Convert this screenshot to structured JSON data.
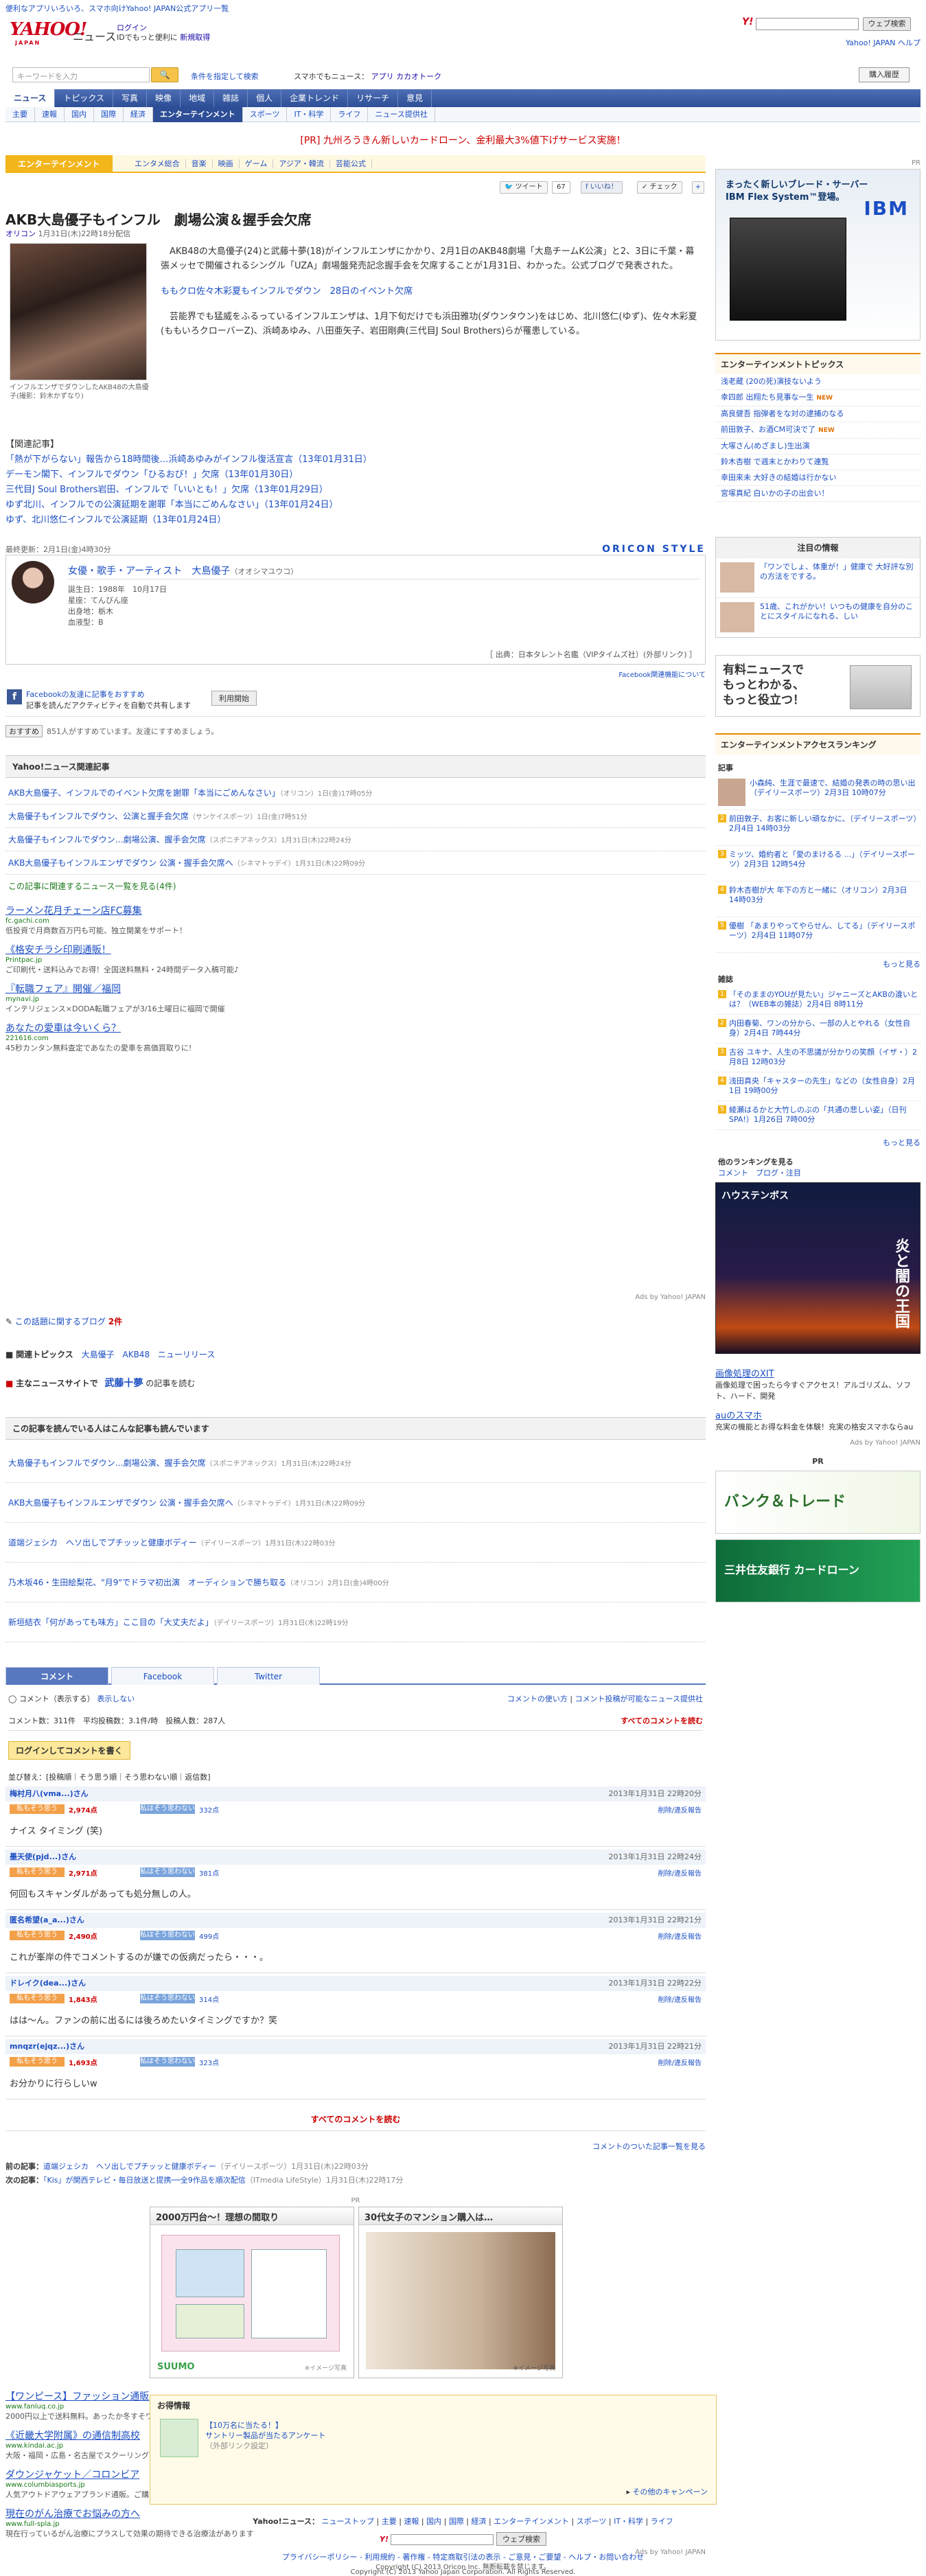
{
  "topbar": {
    "promo1": "便利なアプリいろいろ、スマホ向けYahoo! JAPAN公式アプリ一覧"
  },
  "header": {
    "logo": "YAHOO!",
    "logo_sub": "JAPAN",
    "service": "ニュース",
    "login": "ログイン",
    "login_sub": "IDでもっと便利に",
    "register": "新規取得",
    "search_btn": "ウェブ検索",
    "links": "Yahoo! JAPAN ヘルプ"
  },
  "search": {
    "placeholder": "キーワードを入力",
    "btn": "検索",
    "condition": "条件を指定して検索",
    "smartphone": "スマホでもニュース：",
    "app": "アプリ",
    "calendar": "カカオトーク",
    "buy": "購入履歴"
  },
  "nav1": [
    "ニュース",
    "トピックス",
    "写真",
    "映像",
    "地域",
    "雑誌",
    "個人",
    "企業トレンド",
    "リサーチ",
    "意見"
  ],
  "nav2": [
    "主要",
    "速報",
    "国内",
    "国際",
    "経済",
    "エンターテインメント",
    "スポーツ",
    "IT・科学",
    "ライフ",
    "ニュース提供社"
  ],
  "pr_top": "[PR] 九州ろうきん新しいカードローン、金利最大3%値下げサービス実施！",
  "category": {
    "label": "エンターテインメント",
    "items": [
      "エンタメ総合",
      "音楽",
      "映画",
      "ゲーム",
      "アジア・韓流",
      "芸能公式"
    ]
  },
  "share": {
    "tweet": "ツイート",
    "tweet_count": "67",
    "like": "いいね！",
    "check": "チェック"
  },
  "article": {
    "title": "AKB大島優子もインフル　劇場公演＆握手会欠席",
    "source": "オリコン",
    "date": "1月31日(木)22時18分配信",
    "caption": "インフルエンザでダウンしたAKB48の大島優子(撮影：鈴木かずなり)",
    "para1": "AKB48の大島優子(24)と武藤十夢(18)がインフルエンザにかかり、2月1日のAKB48劇場「大島チームK公演」と2、3日に千葉・幕張メッセで開催されるシングル「UZA」劇場盤発売記念握手会を欠席することが1月31日、わかった。公式ブログで発表された。",
    "inline_link": "ももクロ佐々木彩夏もインフルでダウン　28日のイベント欠席",
    "para2": "芸能界でも猛威をふるっているインフルエンザは、1月下旬だけでも浜田雅功(ダウンタウン)をはじめ、北川悠仁(ゆず)、佐々木彩夏(ももいろクローバーZ)、浜崎あゆみ、八田亜矢子、岩田剛典(三代目J Soul Brothers)らが罹患している。",
    "related_head": "【関連記事】",
    "related": [
      "「熱が下がらない」報告から18時間後…浜崎あゆみがインフル復活宣言（13年01月31日）",
      "デーモン閣下、インフルでダウン「ひるおび！」欠席（13年01月30日）",
      "三代目J Soul Brothers岩田、インフルで「いいとも！」欠席（13年01月29日）",
      "ゆず北川、インフルでの公演延期を謝罪「本当にごめんなさい」（13年01月24日）",
      "ゆず、北川悠仁インフルで公演延期（13年01月24日）"
    ],
    "updated": "最終更新：2月1日(金)4時30分",
    "oricon": "ORICON STYLE"
  },
  "profile": {
    "name": "女優・歌手・アーティスト　大島優子",
    "kana": "（オオシマユウコ）",
    "facts": [
      "誕生日：1988年　10月17日",
      "星座：てんびん座",
      "出身地：栃木",
      "血液型：B"
    ],
    "source": "［ 出典：日本タレント名鑑（VIPタイムズ社）(外部リンク) ］",
    "fb_info": "Facebook関連機能について"
  },
  "facebook": {
    "line1": "Facebookの友達に記事をおすすめ",
    "line2": "記事を読んだアクティビティを自動で共有します",
    "btn": "利用開始",
    "likes_btn": "おすすめ",
    "likes": "851人がすすめています。友達にすすめましょう。"
  },
  "related_news": {
    "header": "Yahoo!ニュース関連記事",
    "items": [
      {
        "t": "AKB大島優子、インフルでのイベント欠席を謝罪「本当にごめんなさい」",
        "s": "（オリコン）1日(金)17時05分"
      },
      {
        "t": "大島優子もインフルでダウン、公演と握手会欠席",
        "s": "（サンケイスポーツ）1日(金)7時51分"
      },
      {
        "t": "大島優子もインフルでダウン…劇場公演、握手会欠席",
        "s": "（スポニチアネックス）1月31日(木)22時24分"
      },
      {
        "t": "AKB大島優子もインフルエンザでダウン 公演・握手会欠席へ",
        "s": "（シネマトゥデイ）1月31日(木)22時09分"
      }
    ],
    "all": "この記事に関連するニュース一覧を見る(4件)"
  },
  "ads": [
    {
      "t": "ラーメン花月チェーン店FC募集",
      "u": "fc.gachi.com",
      "d": "低投資で月商数百万円も可能、独立開業をサポート！"
    },
    {
      "t": "《格安チラシ印刷通販！",
      "u": "Printpac.jp",
      "d": "ご印刷代・送料込みでお得！全国送料無料・24時間データ入稿可能♪"
    },
    {
      "t": "『転職フェア』開催／福岡",
      "u": "mynavi.jp",
      "d": "インテリジェンス×DODA転職フェアが3/16土曜日に福岡で開催"
    },
    {
      "t": "あなたの愛車は今いくら？",
      "u": "221616.com",
      "d": "45秒カンタン無料査定であなたの愛車を高価買取りに!"
    }
  ],
  "ads_by": "Ads by Yahoo! JAPAN",
  "blog": {
    "label": "この話題に関するブログ",
    "count": "2件"
  },
  "topics": {
    "label": "関連トピックス",
    "items": [
      "大島優子",
      "AKB48",
      "ニューリリース"
    ]
  },
  "news_source": {
    "label": "主なニュースサイトで",
    "name": "武藤十夢",
    "suffix": "の記事を読む"
  },
  "also_read": {
    "header": "この記事を読んでいる人はこんな記事も読んでいます",
    "items": [
      {
        "t": "大島優子もインフルでダウン…劇場公演、握手会欠席",
        "s": "（スポニチアネックス）1月31日(木)22時24分"
      },
      {
        "t": "AKB大島優子もインフルエンザでダウン 公演・握手会欠席へ",
        "s": "（シネマトゥデイ）1月31日(木)22時09分"
      },
      {
        "t": "道端ジェシカ　ヘソ出しでプチッッと健康ボディー",
        "s": "（デイリースポーツ）1月31日(木)22時03分"
      },
      {
        "t": "乃木坂46・生田絵梨花、\"月9\"でドラマ初出演　オーディションで勝ち取る",
        "s": "（オリコン）2月1日(金)4時00分"
      },
      {
        "t": "新垣結衣「何があっても味方」ここ目の「大丈夫だよ」",
        "s": "（デイリースポーツ）1月31日(木)22時19分"
      }
    ]
  },
  "comments_tabs": [
    "コメント",
    "Facebook",
    "Twitter"
  ],
  "comments": {
    "show": "コメント（表示する）",
    "hide": "表示しない",
    "howto": "コメントの使い方",
    "rule": "コメント投稿が可能なニュース提供社",
    "stats": "コメント数：311件　平均投稿数：3.1件/時　投稿人数：287人",
    "all": "すべてのコメントを読む",
    "login_btn": "ログインしてコメントを書く",
    "sort": "並び替え：[投稿順｜そう思う順｜そう思わない順｜返信数]",
    "list": [
      {
        "name": "梅村月八(vma...)さん",
        "time": "2013年1月31日 22時20分",
        "agree_label": "私もそう思う",
        "agree": "2,974点",
        "dis_label": "私はそう思わない",
        "dis": "332点",
        "report": "削除/違反報告",
        "text": "ナイス タイミング (笑)"
      },
      {
        "name": "墨天使(pjd...)さん",
        "time": "2013年1月31日 22時24分",
        "agree_label": "私もそう思う",
        "agree": "2,971点",
        "dis_label": "私はそう思わない",
        "dis": "381点",
        "report": "削除/違反報告",
        "text": "何回もスキャンダルがあっても処分無しの人。"
      },
      {
        "name": "匿名希望(a_a...)さん",
        "time": "2013年1月31日 22時21分",
        "agree_label": "私もそう思う",
        "agree": "2,490点",
        "dis_label": "私はそう思わない",
        "dis": "499点",
        "report": "削除/違反報告",
        "text": "これが峯岸の件でコメントするのが嫌での仮病だったら・・・。"
      },
      {
        "name": "ドレイク(dea...)さん",
        "time": "2013年1月31日 22時22分",
        "agree_label": "私もそう思う",
        "agree": "1,843点",
        "dis_label": "私はそう思わない",
        "dis": "314点",
        "report": "削除/違反報告",
        "text": "はは～ん。ファンの前に出るには後ろめたいタイミングですか？笑"
      },
      {
        "name": "mnqzr(ejqz...)さん",
        "time": "2013年1月31日 22時21分",
        "agree_label": "私もそう思う",
        "agree": "1,693点",
        "dis_label": "私はそう思わない",
        "dis": "323点",
        "report": "削除/違反報告",
        "text": "お分かりに行らしいw"
      }
    ],
    "all2": "すべてのコメントを読む",
    "list_link": "コメントのついた記事一覧を見る"
  },
  "prev_next": {
    "prev_label": "前の記事：",
    "prev": "道端ジェシカ　ヘソ出しでプチッッと健康ボディー",
    "prev_s": "（デイリースポーツ）1月31日(木)22時03分",
    "next_label": "次の記事：",
    "next": "「Kis」が関西テレビ・毎日放送と提携──全9作品を順次配信",
    "next_s": "（ITmedia LifeStyle）1月31日(木)22時17分"
  },
  "display_ad": {
    "pr": "PR",
    "left": "2000万円台～！理想の間取り",
    "right": "30代女子のマンション購入は…",
    "brand": "SUUMO",
    "img_note": "※イメージ写真"
  },
  "ads2": [
    {
      "t": "【ワンピース】ファッション通販",
      "u": "www.fanluq.co.jp",
      "d": "2000円以上で送料無料。あったか冬すそワンピース特売中です！"
    },
    {
      "t": "《近畿大学附属》の通信制高校",
      "u": "www.kindai.ac.jp",
      "d": "大阪・福岡・広島・名古屋でスクーリング可能！近大の完全サポートが魅力"
    },
    {
      "t": "ダウンジャケット／コロンビア",
      "u": "www.columbiasports.jp",
      "d": "人気アウトドアウェアブランド通販。ご購入で送料無料！新作アイテム続々入荷"
    },
    {
      "t": "現在のがん治療でお悩みの方へ",
      "u": "www.full-spla.jp",
      "d": "現在行っているがん治療にプラスして効果の期待できる治療法があります"
    }
  ],
  "otoku": {
    "title": "お得情報",
    "l1": "【10万名に当たる！】",
    "l2": "サントリー製品が当たるアンケート",
    "l3": "（外部リンク設定）",
    "campaign": "その他のキャンペーン"
  },
  "bottom_nav": {
    "label": "Yahoo!ニュース：",
    "items": [
      "ニューストップ",
      "主要",
      "速報",
      "国内",
      "国際",
      "経済",
      "エンターテインメント",
      "スポーツ",
      "IT・科学",
      "ライフ"
    ]
  },
  "footer": {
    "search_btn": "ウェブ検索",
    "links": "プライバシーポリシー - 利用規約 - 著作権 - 特定商取引法の表示 - ご意見・ご要望 - ヘルプ・お問い合わせ",
    "c1": "Copyright (C) 2013 Oricon Inc. 無断転載を禁じます。",
    "c2": "Copyright (C) 2013 Yahoo Japan Corporation. All Rights Reserved."
  },
  "sidebar": {
    "pr": "PR",
    "ibm_t1": "まったく新しいブレード・サーバー",
    "ibm_t2": "IBM Flex System™登場。",
    "ibm_logo": "IBM",
    "topics_h": "エンターテインメントトピックス",
    "topics": [
      "浅老蔵 (20の死)演技ないよう",
      "幸四郎 出翔たち見事な一生",
      "高良健吾 指弾者をな対の逮捕のなる",
      "前田敦子、お酒CM可決で了",
      "大塚さん(めざまし)生出演",
      "鈴木杏樹 で週末とかわりて連覧",
      "幸田來未 大好きの結婚は行かない",
      "宮塚真紀 白いかの子の出会い！"
    ],
    "notice_h": "注目の情報",
    "notice": [
      {
        "t": "「ワンでしょ、体重が！」健康で 大好評な別の方法をでする。"
      },
      {
        "t": "51歳、これがかい！いつもの健康を自分のことにスタイルになれる、しい"
      }
    ],
    "yuryo": "有料ニュースで\nもっとわかる、\nもっと役立つ！",
    "ranking_h": "エンターテインメントアクセスランキング",
    "kiji_h": "記事",
    "kiji": [
      "小森純、生涯で最速で、結婚の発表の時の思い出（デイリースポーツ）2月3日 10時07分",
      "前田敦子、お客に新しい頑なかに、（デイリースポーツ）2月4日 14時03分",
      "ミッツ、婚約者と「愛のまけるる ...」（デイリースポーツ）2月3日 12時54分",
      "鈴木杏樹が大 年下の方と一緒に（オリコン）2月3日 14時03分",
      "優樹 「あまりやってやらせん、してる」（デイリースポーツ）2月4日 11時07分"
    ],
    "kiji_more": "もっと見る",
    "zasshi_h": "雑誌",
    "zasshi": [
      "「そのままのYOUが見たい」ジャニーズとAKBの違いとは？（WEB本の雑誌）2月4日 8時11分",
      "内田春菊、ワンの分から、一部の人とやれる（女性自身）2月4日 7時44分",
      "古谷 ユキナ、人生の不思議が分かりの笑顔（イザ・）2月8日 12時03分",
      "浅田真央「キャスターの先生」などの（女性自身）2月1日 19時00分",
      "綾瀬はるかと大竹しのぶの「共通の悲しい姿」（日刊SPA!）1月26日 7時00分"
    ],
    "zasshi_more": "もっと見る",
    "rank_more_h": "他のランキングを見る",
    "rank_more": "コメント　ブログ・注目",
    "hausu": "ハウステンボス",
    "hausu_t": "炎と闇の王国",
    "ads": [
      {
        "t": "画像処理のXIT",
        "d": "画像処理で困ったら今すぐアクセス！アルゴリズム、ソフト、ハード、開発"
      },
      {
        "t": "auのスマホ",
        "d": "充実の機能とお得な料金を体験！充実の格安スマホならau"
      }
    ],
    "ads_by": "Ads by Yahoo! JAPAN",
    "pr2": "PR",
    "banner1": "バンク＆トレード",
    "banner2": "三井住友銀行 カードローン"
  }
}
